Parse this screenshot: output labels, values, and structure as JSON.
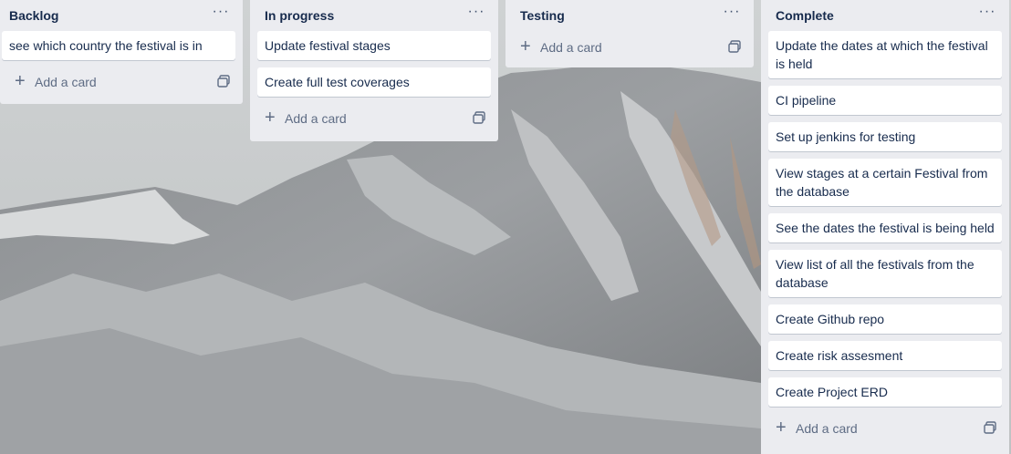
{
  "board": {
    "lists": [
      {
        "title": "Backlog",
        "menu_icon": "ellipsis-icon",
        "cards": [
          "see which country the festival is in"
        ],
        "add_label": "Add a card"
      },
      {
        "title": "In progress",
        "menu_icon": "ellipsis-icon",
        "cards": [
          "Update festival stages",
          "Create full test coverages"
        ],
        "add_label": "Add a card"
      },
      {
        "title": "Testing",
        "menu_icon": "ellipsis-icon",
        "cards": [],
        "add_label": "Add a card"
      },
      {
        "title": "Complete",
        "menu_icon": "ellipsis-icon",
        "cards": [
          "Update the dates at which the festival is held",
          "CI pipeline",
          "Set up jenkins for testing",
          "View stages at a certain Festival from the database",
          "See the dates the festival is being held",
          "View list of all the festivals from the database",
          "Create Github repo",
          "Create risk assesment",
          "Create Project ERD"
        ],
        "add_label": "Add a card"
      }
    ],
    "menu_glyph": "···",
    "add_glyph": "+",
    "colors": {
      "list_bg": "#ebecf0",
      "card_bg": "#ffffff",
      "text": "#172b4d",
      "muted": "#5e6c84"
    },
    "icons": [
      "ellipsis-icon",
      "plus-icon",
      "card-template-icon"
    ]
  }
}
